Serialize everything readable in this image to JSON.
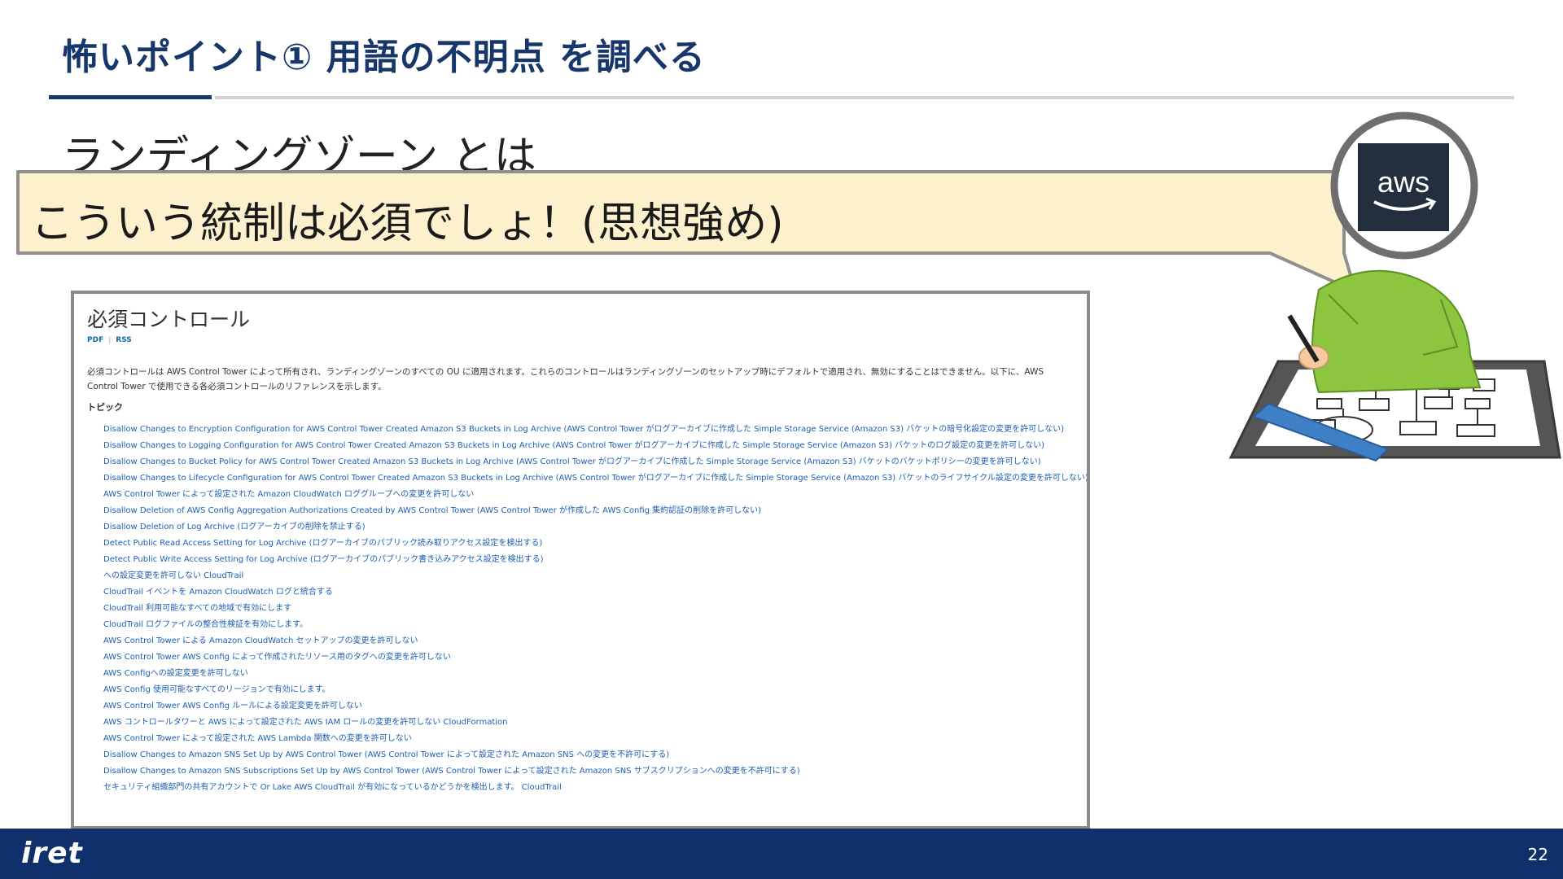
{
  "slide": {
    "title": "怖いポイント① 用語の不明点 を調べる",
    "subtitle": "ランディングゾーン とは",
    "callout": "こういう統制は必須でしょ！(思想強め)",
    "page_number": "22"
  },
  "footer": {
    "logo": "iret"
  },
  "avatar": {
    "logo_text": "aws"
  },
  "document": {
    "heading": "必須コントロール",
    "links": [
      "PDF",
      "RSS"
    ],
    "intro": "必須コントロールは AWS Control Tower によって所有され、ランディングゾーンのすべての OU に適用されます。これらのコントロールはランディングゾーンのセットアップ時にデフォルトで適用され、無効にすることはできません。以下に、AWS Control Tower で使用できる各必須コントロールのリファレンスを示します。",
    "topic_label": "トピック",
    "items": [
      "Disallow Changes to Encryption Configuration for AWS Control Tower Created Amazon S3 Buckets in Log Archive (AWS Control Tower がログアーカイブに作成した Simple Storage Service (Amazon S3) バケットの暗号化設定の変更を許可しない)",
      "Disallow Changes to Logging Configuration for AWS Control Tower Created Amazon S3 Buckets in Log Archive (AWS Control Tower がログアーカイブに作成した Simple Storage Service (Amazon S3) バケットのログ設定の変更を許可しない)",
      "Disallow Changes to Bucket Policy for AWS Control Tower Created Amazon S3 Buckets in Log Archive (AWS Control Tower がログアーカイブに作成した Simple Storage Service (Amazon S3) バケットのバケットポリシーの変更を許可しない)",
      "Disallow Changes to Lifecycle Configuration for AWS Control Tower Created Amazon S3 Buckets in Log Archive (AWS Control Tower がログアーカイブに作成した Simple Storage Service (Amazon S3) バケットのライフサイクル設定の変更を許可しない)",
      "AWS Control Tower によって設定された Amazon CloudWatch ロググループへの変更を許可しない",
      "Disallow Deletion of AWS Config Aggregation Authorizations Created by AWS Control Tower (AWS Control Tower が作成した AWS Config 集約認証の削除を許可しない)",
      "Disallow Deletion of Log Archive (ログアーカイブの削除を禁止する)",
      "Detect Public Read Access Setting for Log Archive (ログアーカイブのパブリック読み取りアクセス設定を検出する)",
      "Detect Public Write Access Setting for Log Archive (ログアーカイブのパブリック書き込みアクセス設定を検出する)",
      "への設定変更を許可しない CloudTrail",
      "CloudTrail イベントを Amazon CloudWatch ログと統合する",
      "CloudTrail 利用可能なすべての地域で有効にします",
      "CloudTrail ログファイルの整合性検証を有効にします。",
      "AWS Control Tower による Amazon CloudWatch セットアップの変更を許可しない",
      "AWS Control Tower AWS Config によって作成されたリソース用のタグへの変更を許可しない",
      "AWS Configへの設定変更を許可しない",
      "AWS Config 使用可能なすべてのリージョンで有効にします。",
      "AWS Control Tower AWS Config ルールによる設定変更を許可しない",
      "AWS コントロールタワーと AWS によって設定された AWS IAM ロールの変更を許可しない CloudFormation",
      "AWS Control Tower によって設定された AWS Lambda 関数への変更を許可しない",
      "Disallow Changes to Amazon SNS Set Up by AWS Control Tower (AWS Control Tower によって設定された Amazon SNS への変更を不許可にする)",
      "Disallow Changes to Amazon SNS Subscriptions Set Up by AWS Control Tower (AWS Control Tower によって設定された Amazon SNS サブスクリプションへの変更を不許可にする)",
      "セキュリティ組織部門の共有アカウントで Or Lake AWS CloudTrail が有効になっているかどうかを検出します。 CloudTrail"
    ]
  },
  "colors": {
    "title": "#17376b",
    "footer": "#10306b",
    "callout_fill": "#fdf0cd",
    "link": "#1c5fb3",
    "aws_bg": "#232f3e"
  }
}
